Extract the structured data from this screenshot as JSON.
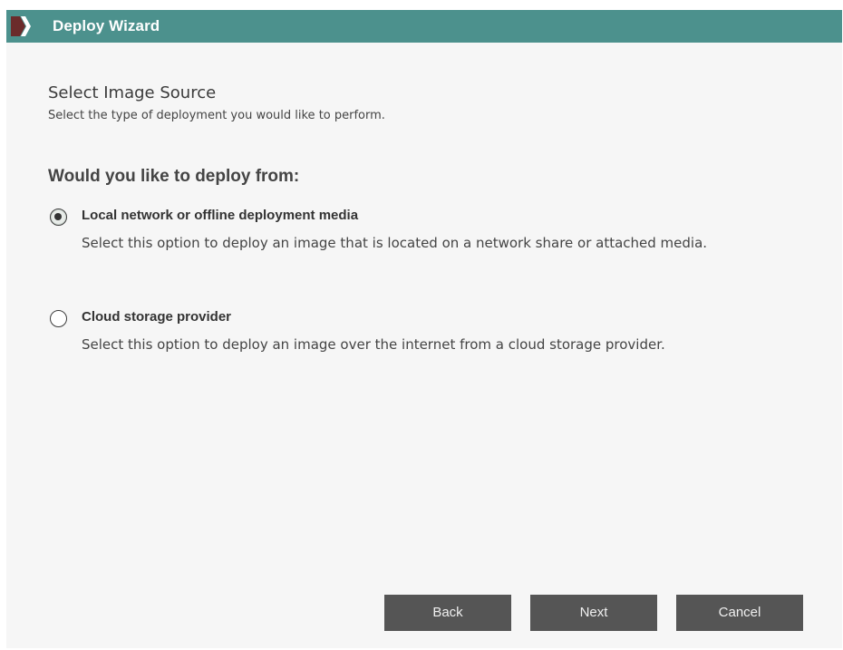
{
  "window": {
    "title": "Deploy Wizard"
  },
  "page": {
    "heading": "Select Image Source",
    "subheading": "Select the type of deployment you would like to perform."
  },
  "question": "Would you like to deploy from:",
  "options": [
    {
      "label": "Local network or offline deployment media",
      "description": "Select this option to deploy an image that is located on a network share or attached media.",
      "selected": true
    },
    {
      "label": "Cloud storage provider",
      "description": "Select this option to deploy an image over the internet from a cloud storage provider.",
      "selected": false
    }
  ],
  "buttons": {
    "back": "Back",
    "next": "Next",
    "cancel": "Cancel"
  },
  "colors": {
    "titlebar": "#4c918d",
    "button": "#555555",
    "background": "#f6f6f6"
  },
  "icons": {
    "logo": "wizard-logo-icon"
  }
}
